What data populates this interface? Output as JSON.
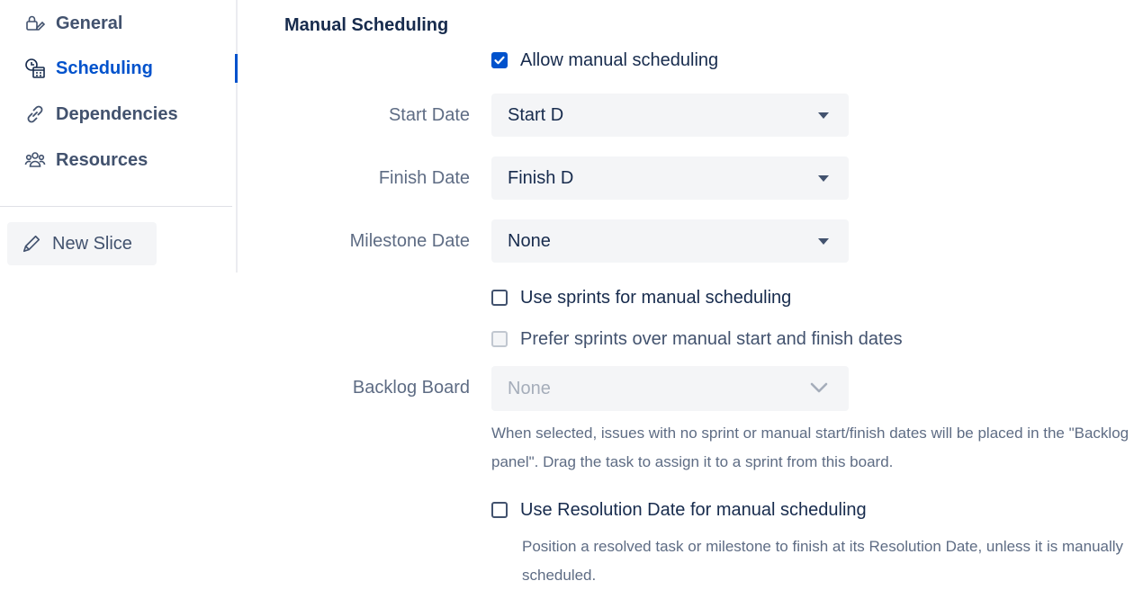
{
  "sidebar": {
    "items": [
      {
        "label": "General",
        "icon": "edit-lock-icon"
      },
      {
        "label": "Scheduling",
        "icon": "clock-calendar-icon"
      },
      {
        "label": "Dependencies",
        "icon": "link-icon"
      },
      {
        "label": "Resources",
        "icon": "people-icon"
      }
    ],
    "new_slice": "New Slice"
  },
  "main": {
    "title": "Manual Scheduling",
    "allow_manual": "Allow manual scheduling",
    "start_date": {
      "label": "Start Date",
      "value": "Start D"
    },
    "finish_date": {
      "label": "Finish Date",
      "value": "Finish D"
    },
    "milestone_date": {
      "label": "Milestone Date",
      "value": "None"
    },
    "use_sprints": "Use sprints for manual scheduling",
    "prefer_sprints": "Prefer sprints over manual start and finish dates",
    "backlog_board": {
      "label": "Backlog Board",
      "value": "None"
    },
    "backlog_help": "When selected, issues with no sprint or manual start/finish dates will be placed in the \"Backlog panel\". Drag the task to assign it to a sprint from this board.",
    "use_resolution": "Use Resolution Date for manual scheduling",
    "resolution_help": "Position a resolved task or milestone to finish at its Resolution Date, unless it is manually scheduled."
  },
  "colors": {
    "accent": "#0052cc",
    "text": "#172b4d",
    "muted": "#5e6c84",
    "field_bg": "#f4f5f7"
  }
}
